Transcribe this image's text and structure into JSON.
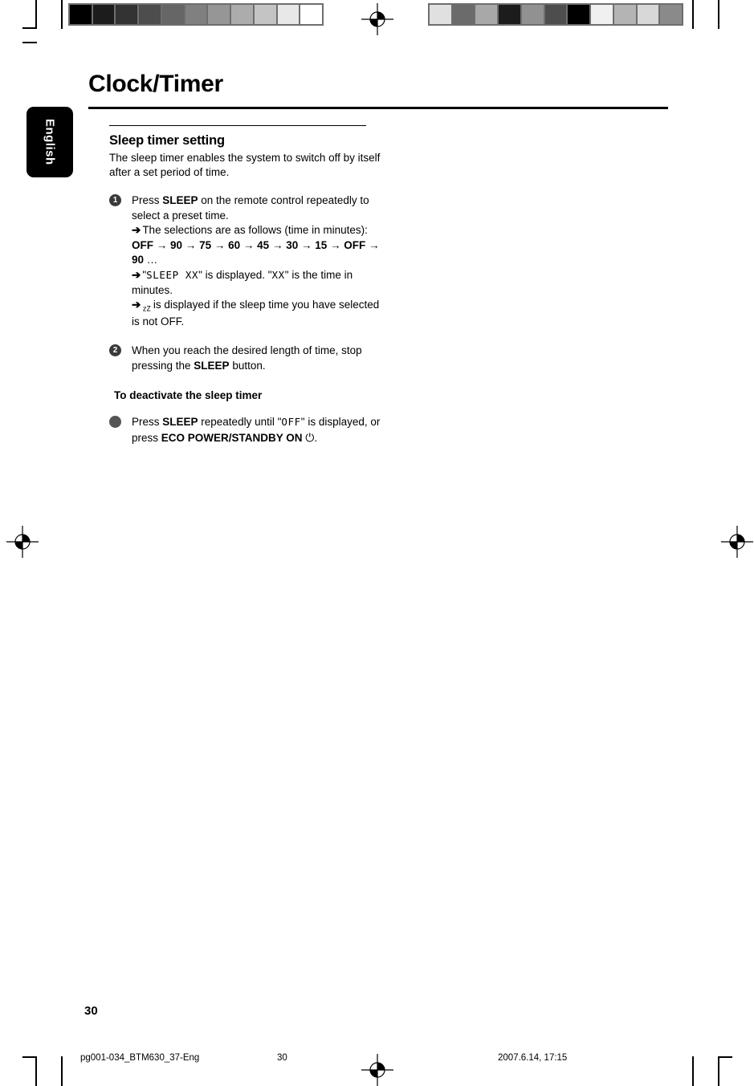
{
  "language_tab": "English",
  "page_title": "Clock/Timer",
  "section": {
    "heading": "Sleep timer setting",
    "intro": "The sleep timer enables the system to switch off by itself after a set period of time."
  },
  "steps": [
    {
      "marker": "1",
      "text_before": "Press ",
      "bold": "SLEEP",
      "text_after": " on the remote control repeatedly to select a preset time.",
      "results": [
        {
          "arrow": "➔",
          "text": "The selections are as follows (time in minutes):"
        }
      ],
      "presets": {
        "values": [
          "OFF",
          "90",
          "75",
          "60",
          "45",
          "30",
          "15",
          "OFF",
          "90"
        ],
        "separator": "→",
        "ellipsis": "…"
      },
      "results2": [
        {
          "arrow": "➔",
          "lcd_before": "SLEEP  XX",
          "mid": " is displayed. ",
          "lcd_after": "XX",
          "end": " is the time in minutes."
        },
        {
          "arrow": "➔",
          "icon": "zZ",
          "text": " is displayed if the sleep time you have selected is not OFF."
        }
      ]
    },
    {
      "marker": "2",
      "text_before": "When you reach the desired length of time, stop pressing the ",
      "bold": "SLEEP",
      "text_after": " button."
    }
  ],
  "deactivate": {
    "heading": "To deactivate the sleep timer",
    "text_before": "Press ",
    "bold1": "SLEEP",
    "text_mid": " repeatedly until \"",
    "lcd": "OFF",
    "text_mid2": "\" is displayed, or press ",
    "bold2": "ECO POWER/STANDBY ON",
    "power_symbol": "⏻",
    "text_end": "."
  },
  "folio": "30",
  "footer": {
    "file": "pg001-034_BTM630_37-Eng",
    "page": "30",
    "date": "2007.6.14, 17:15"
  },
  "calibration": {
    "left_bar": [
      "#000000",
      "#1c1c1c",
      "#333333",
      "#4d4d4d",
      "#666666",
      "#808080",
      "#969696",
      "#acacac",
      "#c4c4c4",
      "#e8e8e8",
      "#ffffff"
    ],
    "right_bar": [
      "#e0e0e0",
      "#6b6b6b",
      "#a8a8a8",
      "#1c1c1c",
      "#919191",
      "#4d4d4d",
      "#000000",
      "#f0f0f0",
      "#b4b4b4",
      "#d8d8d8",
      "#8a8a8a"
    ]
  }
}
